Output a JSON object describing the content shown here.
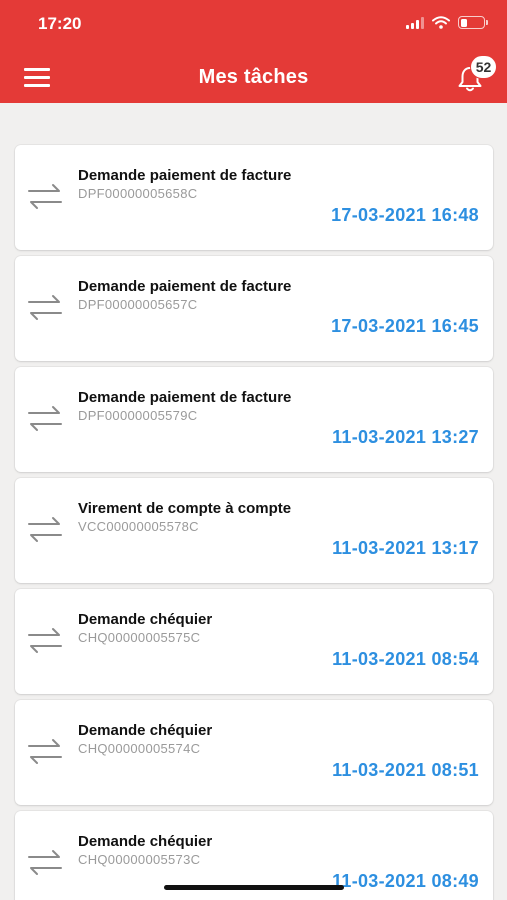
{
  "status_bar": {
    "time": "17:20",
    "battery_level": 0.3
  },
  "header": {
    "title": "Mes tâches",
    "notification_count": "52"
  },
  "tasks": [
    {
      "title": "Demande paiement de facture",
      "ref": "DPF00000005658C",
      "date": "17-03-2021 16:48"
    },
    {
      "title": "Demande paiement de facture",
      "ref": "DPF00000005657C",
      "date": "17-03-2021 16:45"
    },
    {
      "title": "Demande paiement de facture",
      "ref": "DPF00000005579C",
      "date": "11-03-2021 13:27"
    },
    {
      "title": "Virement de compte à compte",
      "ref": "VCC00000005578C",
      "date": "11-03-2021 13:17"
    },
    {
      "title": "Demande chéquier",
      "ref": "CHQ00000005575C",
      "date": "11-03-2021 08:54"
    },
    {
      "title": "Demande chéquier",
      "ref": "CHQ00000005574C",
      "date": "11-03-2021 08:51"
    },
    {
      "title": "Demande chéquier",
      "ref": "CHQ00000005573C",
      "date": "11-03-2021 08:49"
    }
  ],
  "icons": {
    "task": "transfer-arrows-icon",
    "menu": "hamburger-menu-icon",
    "notifications": "bell-icon"
  },
  "colors": {
    "header": "#e43a37",
    "date": "#2d8fe0"
  }
}
